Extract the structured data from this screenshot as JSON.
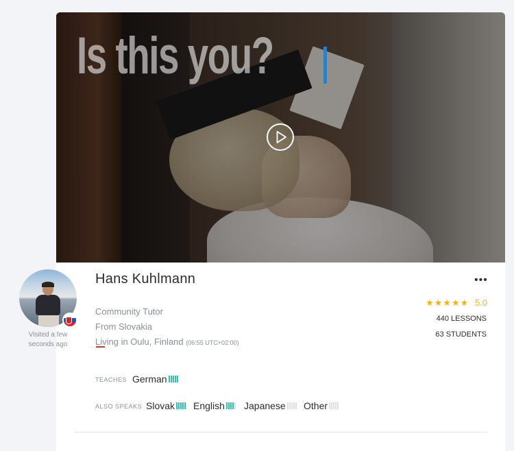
{
  "video": {
    "headline": "Is this you?",
    "play_icon": "play-icon"
  },
  "profile": {
    "name": "Hans Kuhlmann",
    "role": "Community Tutor",
    "from": "From Slovakia",
    "living": "Living in Oulu, Finland",
    "local_time": "(06:55 UTC+02:00)",
    "visited": "Visited a few seconds ago",
    "flag_icon": "slovakia-flag-icon"
  },
  "teaches": {
    "label": "TEACHES",
    "languages": [
      {
        "name": "German",
        "level": 5
      }
    ]
  },
  "also_speaks": {
    "label": "ALSO SPEAKS",
    "languages": [
      {
        "name": "Slovak",
        "level": 5
      },
      {
        "name": "English",
        "level": 4
      },
      {
        "name": "Japanese",
        "level": 0
      },
      {
        "name": "Other",
        "level": 0
      }
    ]
  },
  "stats": {
    "stars": "★★★★★",
    "rating": "5.0",
    "lessons": "440 LESSONS",
    "students": "63 STUDENTS",
    "more_icon": "more-options-icon",
    "more_label": "•••"
  },
  "colors": {
    "accent_star": "#f5b40c",
    "level_on": "#2fc2b4",
    "level_off": "#dde0e5",
    "caret": "#2f7fc1",
    "dash": "#e0322d"
  }
}
